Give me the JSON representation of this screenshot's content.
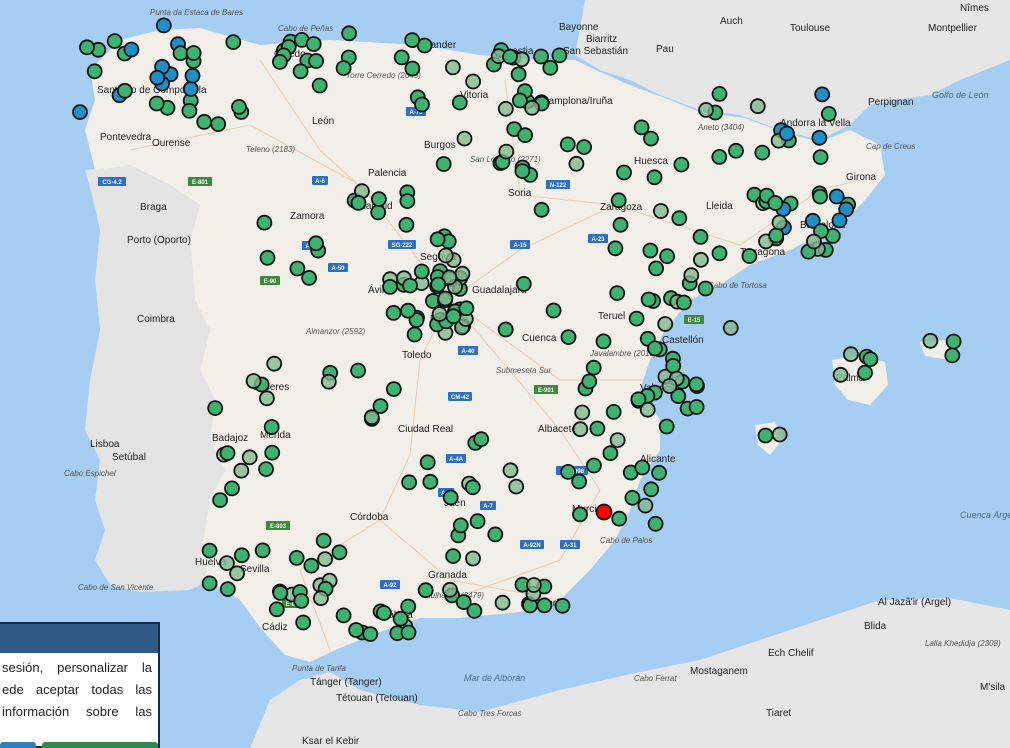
{
  "map": {
    "colors": {
      "sea": "#a6cdf2",
      "land": "#f2efe9",
      "neighbor": "#e4e4e4",
      "station_green": "#3cb371",
      "station_blue": "#1e90c8",
      "station_red": "#ff0000",
      "station_faded": "#7fb98f"
    },
    "labels": {
      "cities": [
        "Santiago de Compostela",
        "Oviedo",
        "Santander",
        "Donostia",
        "San Sebastián",
        "Vitoria",
        "Pamplona/Iruña",
        "Pontevedra",
        "Ourense",
        "León",
        "Burgos",
        "Palencia",
        "Valladolid",
        "Zamora",
        "Soria",
        "Huesca",
        "Zaragoza",
        "Lleida",
        "Girona",
        "Barcelona",
        "Tarragona",
        "Ávila",
        "Segovia",
        "Guadalajara",
        "Madrid",
        "Teruel",
        "Cuenca",
        "Toledo",
        "Castellón",
        "Valencia",
        "Cáceres",
        "Badajoz",
        "Mérida",
        "Ciudad Real",
        "Albacete",
        "Alicante",
        "Murcia",
        "Córdoba",
        "Jaén",
        "Granada",
        "Almería",
        "Sevilla",
        "Huelva",
        "Málaga",
        "Cádiz",
        "Palma",
        "Lisboa",
        "Setúbal",
        "Braga",
        "Porto (Oporto)",
        "Coimbra",
        "Bayonne",
        "Biarritz",
        "Pau",
        "Auch",
        "Toulouse",
        "Nîmes",
        "Montpellier",
        "Perpignan",
        "Andorra la Vella",
        "Tánger (Tanger)",
        "Tétouan (Tetouan)",
        "Ksar el Kebir",
        "Al Jazâ'ir (Argel)",
        "Blida",
        "Ech Chelif",
        "Mostaganem",
        "Tiaret",
        "M'sila"
      ],
      "peaks": [
        "Punta da Estaca de Bares",
        "Cabo de Peñas",
        "Torre Cerredo (2649)",
        "Teleno (2183)",
        "San Lorenzo (2271)",
        "Aneto (3404)",
        "Almanzor (2592)",
        "Javalambre (2018)",
        "Mulhacén (3479)",
        "Cabo de Tortosa",
        "Cabo de Palos",
        "Cabo Espichel",
        "Cabo de San Vicente",
        "Punta de Tarifa",
        "Lalla Khedidja (2308)",
        "Cabo Ferrat",
        "Cabo Tres Forcas",
        "Cap de Creus",
        "Submeseta Sur"
      ],
      "seas": [
        "Golfo de León",
        "Mar de Alborán",
        "Cuenca Argelina"
      ],
      "roads": [
        "CG-4.2",
        "E-801",
        "A-73",
        "A-6",
        "N-122",
        "A-66",
        "A-50",
        "SG-222",
        "A-15",
        "A-23",
        "E-90",
        "E-15",
        "A-40",
        "CM-42",
        "E-901",
        "A-4A",
        "AB-3098",
        "E-803",
        "A-92N",
        "A-92",
        "E-05",
        "A-4",
        "A-7",
        "A-31"
      ]
    },
    "stations": {
      "green_count": 340,
      "blue_count": 42,
      "red_count": 1,
      "note_red_location": "Murcia"
    }
  },
  "cookie_banner": {
    "lines": [
      "sesión, personalizar la",
      "ede aceptar todas las",
      "información sobre las"
    ]
  }
}
